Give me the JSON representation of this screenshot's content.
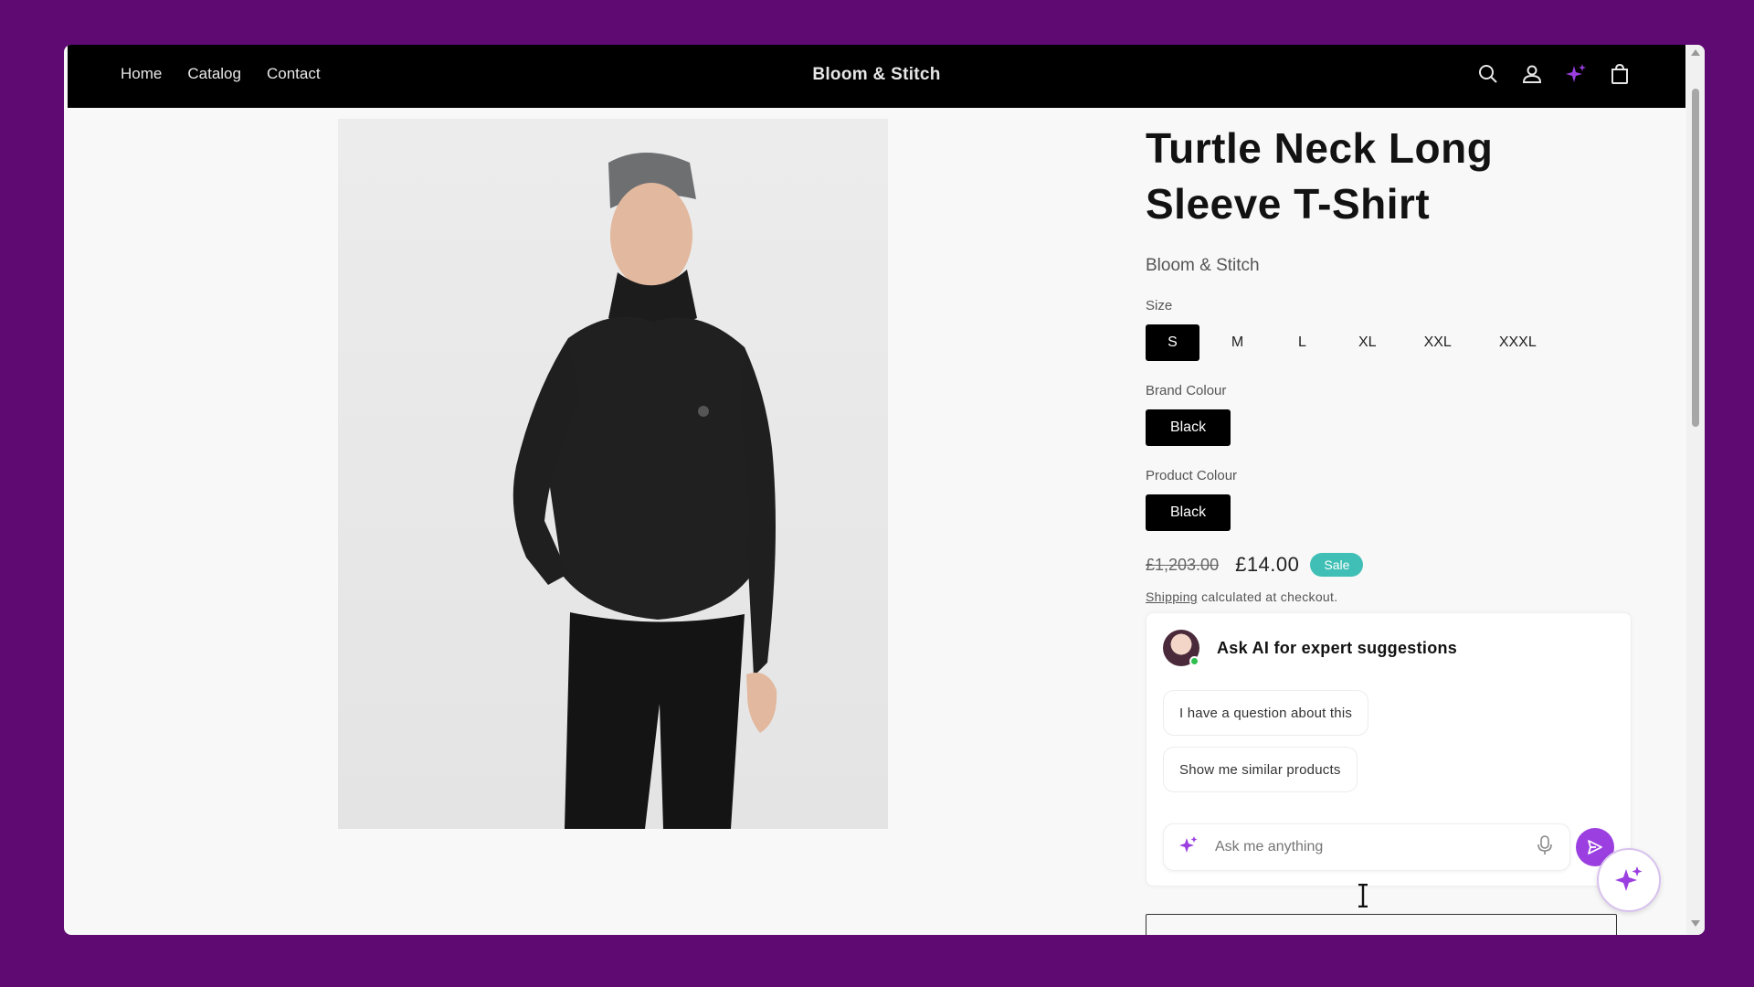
{
  "header": {
    "brand": "Bloom & Stitch",
    "nav": [
      "Home",
      "Catalog",
      "Contact"
    ],
    "icons": [
      "search-icon",
      "account-icon",
      "sparkle-icon",
      "cart-icon"
    ],
    "accent": "#9b3fe0"
  },
  "product": {
    "title": "Turtle Neck Long Sleeve T-Shirt",
    "vendor": "Bloom & Stitch",
    "size_label": "Size",
    "sizes": [
      "S",
      "M",
      "L",
      "XL",
      "XXL",
      "XXXL"
    ],
    "selected_size": "S",
    "brand_colour_label": "Brand Colour",
    "brand_colour": "Black",
    "product_colour_label": "Product Colour",
    "product_colour": "Black",
    "price_old": "£1,203.00",
    "price_new": "£14.00",
    "sale_badge": "Sale",
    "shipping_link": "Shipping",
    "shipping_text": " calculated at checkout."
  },
  "ai": {
    "title": "Ask AI for expert suggestions",
    "chips": [
      "I have a question about this",
      "Show me similar products"
    ],
    "input_placeholder": "Ask me anything"
  },
  "colors": {
    "background": "#5e0a72",
    "sale": "#3fbfb5",
    "online": "#2ec04f"
  }
}
